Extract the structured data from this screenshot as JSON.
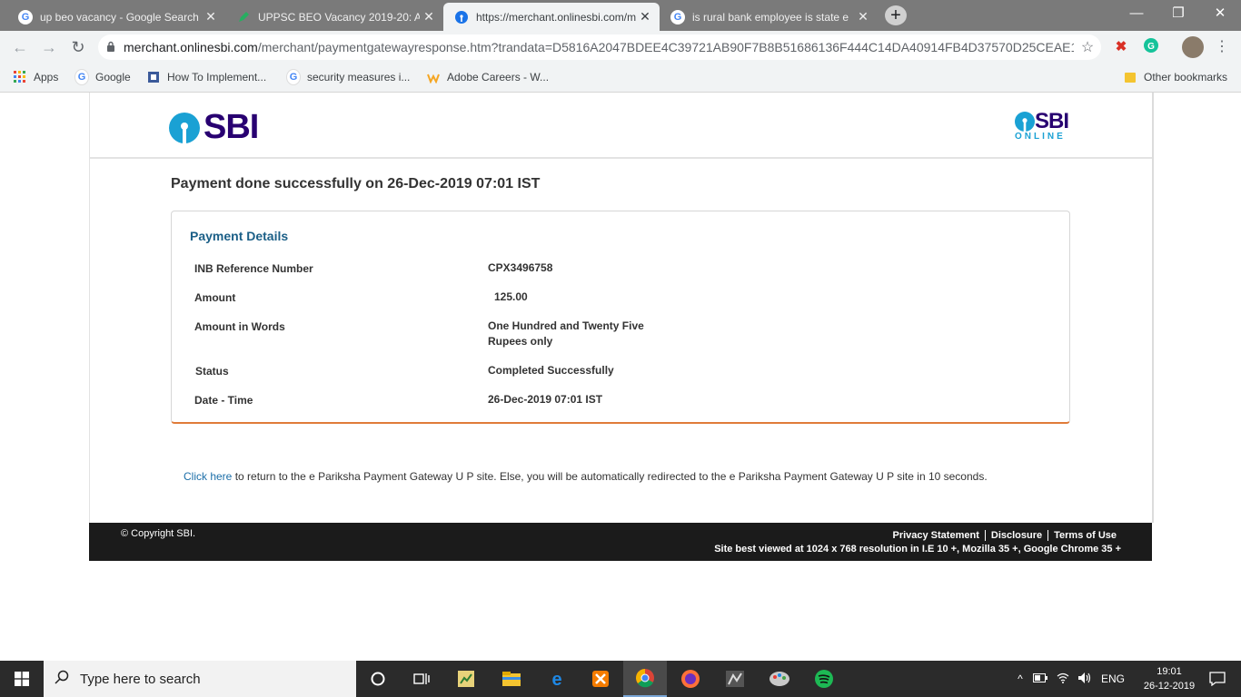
{
  "browser": {
    "tabs": [
      {
        "title": "up beo vacancy - Google Search",
        "icon": "google-icon"
      },
      {
        "title": "UPPSC BEO Vacancy 2019-20: Ap",
        "icon": "pen-icon"
      },
      {
        "title": "https://merchant.onlinesbi.com/m",
        "icon": "sbi-icon",
        "active": true
      },
      {
        "title": "is rural bank employee is state e",
        "icon": "google-icon"
      }
    ],
    "url_host": "merchant.onlinesbi.com",
    "url_path": "/merchant/paymentgatewayresponse.htm?trandata=D5816A2047BDEE4C39721AB90F7B8B51686136F444C14DA40914FB4D37570D25CEAE13...",
    "bookmarks": [
      {
        "label": "Apps"
      },
      {
        "label": "Google"
      },
      {
        "label": "How To Implement..."
      },
      {
        "label": "security measures i..."
      },
      {
        "label": "Adobe Careers - W..."
      }
    ],
    "other_bookmarks": "Other bookmarks"
  },
  "page": {
    "logo_text": "SBI",
    "online_logo_text": "SBI",
    "online_logo_sub": "ONLINE",
    "success_message": "Payment done successfully on 26-Dec-2019 07:01 IST",
    "details_title": "Payment Details",
    "details": [
      {
        "label": "INB Reference Number",
        "value": "CPX3496758"
      },
      {
        "label": "Amount",
        "value": "125.00"
      },
      {
        "label": "Amount in Words",
        "value_line1": "One Hundred and Twenty Five",
        "value_line2": "Rupees only"
      },
      {
        "label": "Status",
        "value": "Completed Successfully"
      },
      {
        "label": "Date - Time",
        "value": "26-Dec-2019 07:01 IST"
      }
    ],
    "redirect_link": "Click here",
    "redirect_text": " to return to the e Pariksha Payment Gateway U P site. Else, you will be automatically redirected to the e Pariksha Payment Gateway U P site in 10 seconds.",
    "footer": {
      "copyright": "© Copyright SBI.",
      "links": [
        "Privacy Statement",
        "Disclosure",
        "Terms of Use"
      ],
      "best_viewed": "Site best viewed at 1024 x 768 resolution in I.E 10 +, Mozilla 35 +, Google Chrome 35 +"
    }
  },
  "taskbar": {
    "search_placeholder": "Type here to search",
    "language": "ENG",
    "time": "19:01",
    "date": "26-12-2019"
  },
  "colors": {
    "sbi_purple": "#280071",
    "sbi_blue": "#1aa1d4",
    "details_title": "#1b5f87",
    "box_accent": "#e07b39"
  }
}
